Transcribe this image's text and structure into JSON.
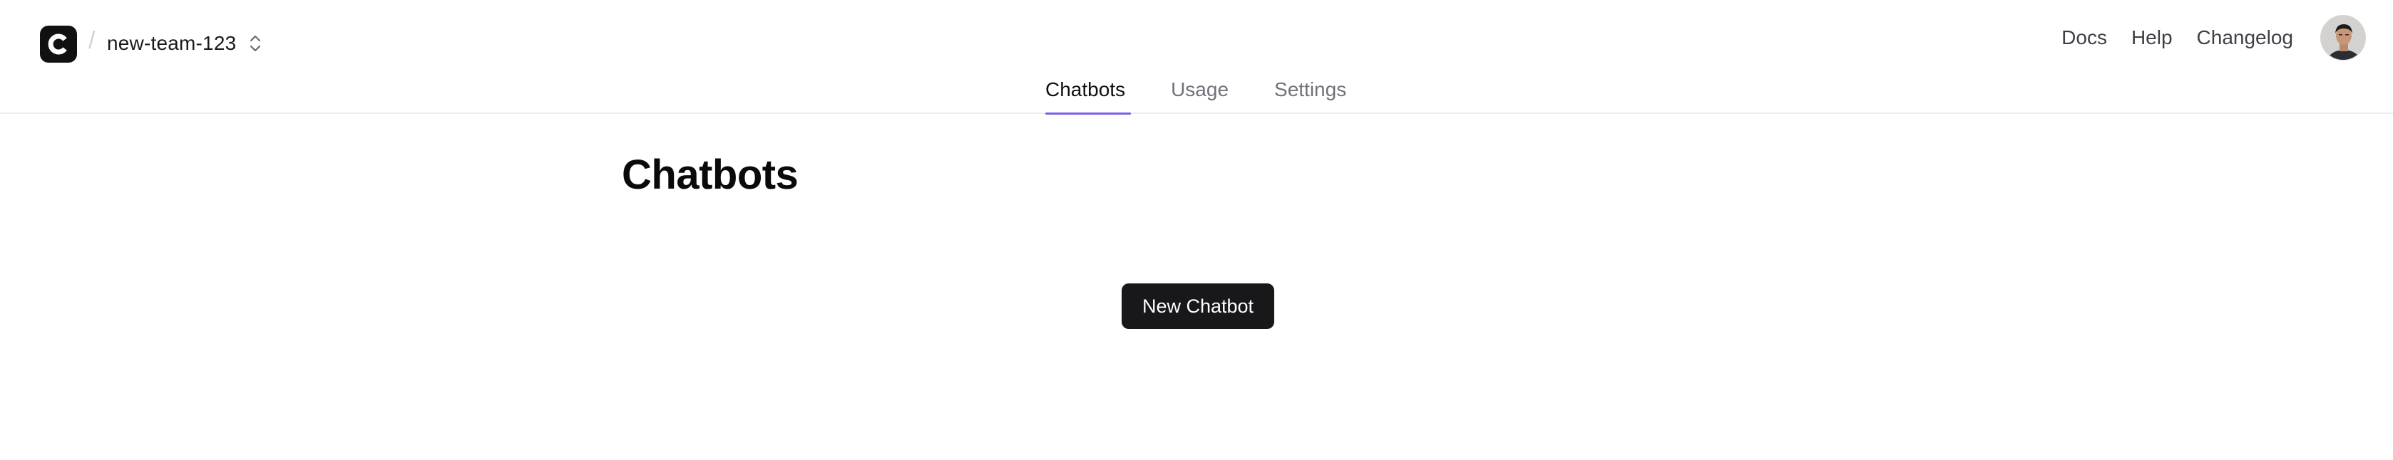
{
  "header": {
    "team_name": "new-team-123",
    "separator": "/",
    "logo_letter": "C",
    "links": [
      {
        "label": "Docs"
      },
      {
        "label": "Help"
      },
      {
        "label": "Changelog"
      }
    ],
    "tabs": [
      {
        "label": "Chatbots",
        "active": true
      },
      {
        "label": "Usage",
        "active": false
      },
      {
        "label": "Settings",
        "active": false
      }
    ]
  },
  "main": {
    "title": "Chatbots",
    "new_button_label": "New Chatbot"
  },
  "colors": {
    "accent": "#7c5ce6",
    "button_bg": "#18181b",
    "logo_bg": "#111111"
  }
}
